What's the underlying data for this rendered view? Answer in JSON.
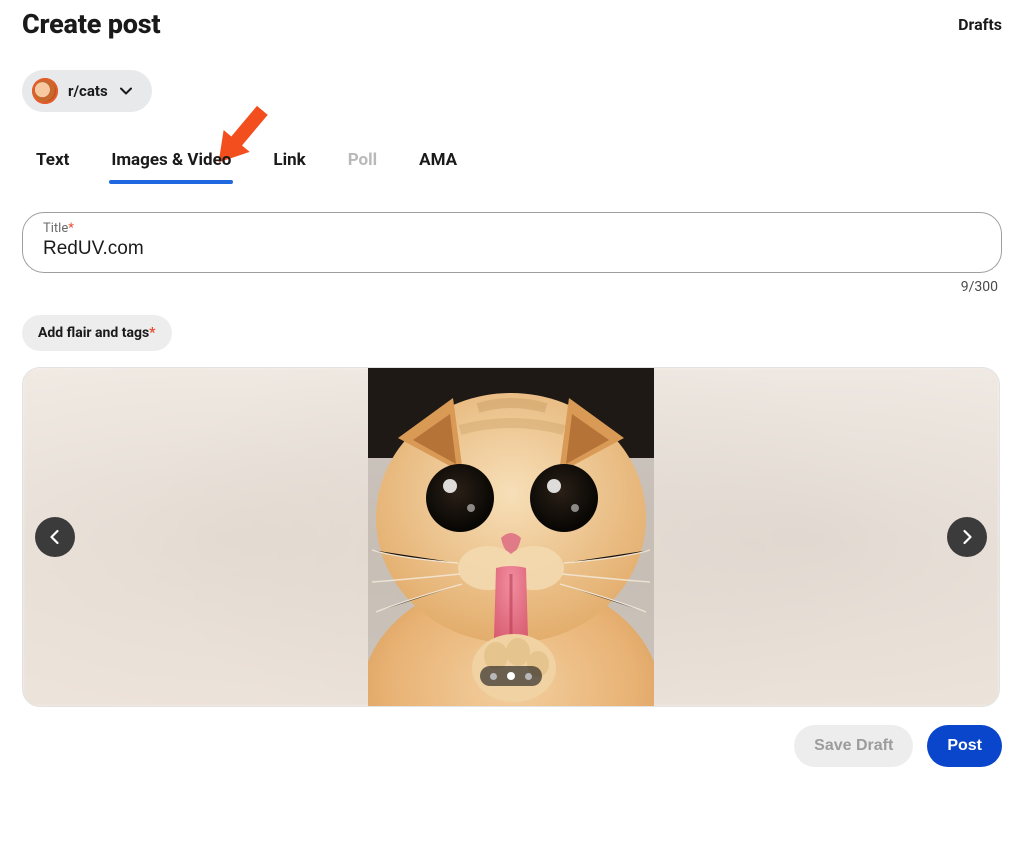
{
  "header": {
    "title": "Create post",
    "drafts_label": "Drafts"
  },
  "community": {
    "name": "r/cats",
    "icon": "cat-face-icon"
  },
  "tabs": [
    {
      "id": "text",
      "label": "Text",
      "active": false,
      "disabled": false
    },
    {
      "id": "images",
      "label": "Images & Video",
      "active": true,
      "disabled": false
    },
    {
      "id": "link",
      "label": "Link",
      "active": false,
      "disabled": false
    },
    {
      "id": "poll",
      "label": "Poll",
      "active": false,
      "disabled": true
    },
    {
      "id": "ama",
      "label": "AMA",
      "active": false,
      "disabled": false
    }
  ],
  "title_field": {
    "label": "Title",
    "required_marker": "*",
    "value": "RedUV.com",
    "count_label": "9/300",
    "max": 300,
    "current": 9
  },
  "flair_chip": {
    "label": "Add flair and tags",
    "required_marker": "*"
  },
  "media": {
    "description": "orange-tabby-cat-licking-tongue",
    "pages_total": 3,
    "page_index": 1,
    "prev_enabled": true,
    "next_enabled": true
  },
  "footer": {
    "save_draft_label": "Save Draft",
    "post_label": "Post",
    "save_draft_enabled": false
  },
  "annotation": {
    "arrow_color": "#f24e1e",
    "target": "tab-images-video"
  }
}
